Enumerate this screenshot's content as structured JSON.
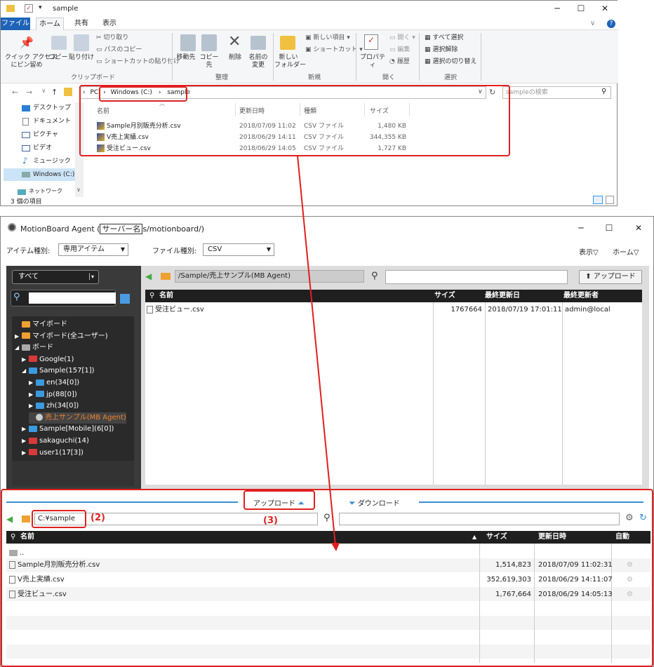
{
  "explorer": {
    "title": "sample",
    "tabs": [
      "ファイル",
      "ホーム",
      "共有",
      "表示"
    ],
    "ribbon": {
      "pin": "クイック アクセス\nにピン留め",
      "copy": "コピー",
      "paste": "貼り付け",
      "cut": "切り取り",
      "copy_path": "パスのコピー",
      "paste_shortcut": "ショートカットの貼り付け",
      "clipboard_group": "クリップボード",
      "move_to": "移動先",
      "copy_to": "コピー先",
      "delete": "削除",
      "rename": "名前の\n変更",
      "organize_group": "整理",
      "new_folder": "新しい\nフォルダー",
      "new_item": "新しい項目 ▾",
      "easy_access": "ショートカット ▾",
      "new_group": "新規",
      "properties": "プロパティ",
      "open": "開く ▾",
      "edit": "編集",
      "history": "履歴",
      "open_group": "開く",
      "select_all": "すべて選択",
      "select_none": "選択解除",
      "invert_selection": "選択の切り替え",
      "select_group": "選択"
    },
    "address": {
      "pc": "PC",
      "drive": "Windows (C:)",
      "folder": "sample"
    },
    "search_placeholder": "sampleの検索",
    "nav_items": [
      "デスクトップ",
      "ドキュメント",
      "ピクチャ",
      "ビデオ",
      "ミュージック",
      "Windows (C:)",
      "ネットワーク"
    ],
    "columns": [
      "名前",
      "更新日時",
      "種類",
      "サイズ"
    ],
    "files": [
      {
        "name": "Sample月別販売分析.csv",
        "date": "2018/07/09 11:02",
        "type": "CSV ファイル",
        "size": "1,480 KB"
      },
      {
        "name": "V売上実績.csv",
        "date": "2018/06/29 14:11",
        "type": "CSV ファイル",
        "size": "344,355 KB"
      },
      {
        "name": "受注ビュー.csv",
        "date": "2018/06/29 14:05",
        "type": "CSV ファイル",
        "size": "1,727 KB"
      }
    ],
    "status": "3 個の項目"
  },
  "mb": {
    "title_prefix": "MotionBoard Agent (",
    "title_server": "サーバー名",
    "title_suffix": "s/motionboard/)",
    "item_type_label": "アイテム種別:",
    "item_type_value": "専用アイテム",
    "file_type_label": "ファイル種別:",
    "file_type_value": "CSV",
    "view_menu": "表示▽",
    "home_menu": "ホーム▽",
    "scope_value": "すべて",
    "path": "/Sample/売上サンプル(MB Agent)",
    "upload_button": "アップロード",
    "tree": [
      {
        "label": "マイボード",
        "color": "or",
        "indent": 0,
        "arrow": ""
      },
      {
        "label": "マイボード(全ユーザー)",
        "color": "or",
        "indent": 0,
        "arrow": "▶"
      },
      {
        "label": "ボード",
        "color": "gray",
        "indent": 0,
        "arrow": "◢"
      },
      {
        "label": "Google(1)",
        "color": "red",
        "indent": 1,
        "arrow": "▶"
      },
      {
        "label": "Sample(157[1])",
        "color": "blue",
        "indent": 1,
        "arrow": "◢"
      },
      {
        "label": "en(34[0])",
        "color": "blue",
        "indent": 2,
        "arrow": "▶"
      },
      {
        "label": "jp(88[0])",
        "color": "blue",
        "indent": 2,
        "arrow": "▶"
      },
      {
        "label": "zh(34[0])",
        "color": "blue",
        "indent": 2,
        "arrow": "▶"
      },
      {
        "label": "売上サンプル(MB Agent)",
        "color": "sel",
        "indent": 2,
        "arrow": ""
      },
      {
        "label": "Sample[Mobile](6[0])",
        "color": "blue",
        "indent": 1,
        "arrow": "▶"
      },
      {
        "label": "sakaguchi(14)",
        "color": "red",
        "indent": 1,
        "arrow": "▶"
      },
      {
        "label": "user1(17[3])",
        "color": "red",
        "indent": 1,
        "arrow": "▶"
      }
    ],
    "server_columns": [
      "名前",
      "サイズ",
      "最終更新日",
      "最終更新者"
    ],
    "server_files": [
      {
        "name": "受注ビュー.csv",
        "size": "1767664",
        "date": "2018/07/19 17:01:11",
        "user": "admin@local"
      }
    ],
    "upload_tab": "アップロード",
    "download_tab": "ダウンロード",
    "local_path": "C:¥sample",
    "local_columns": [
      "名前",
      "サイズ",
      "更新日時",
      "自動"
    ],
    "parent_dir": "..",
    "local_files": [
      {
        "name": "Sample月別販売分析.csv",
        "size": "1,514,823",
        "date": "2018/07/09 11:02:31"
      },
      {
        "name": "V売上実績.csv",
        "size": "352,619,303",
        "date": "2018/06/29 14:11:07"
      },
      {
        "name": "受注ビュー.csv",
        "size": "1,767,664",
        "date": "2018/06/29 14:05:13"
      }
    ]
  },
  "annotations": {
    "a2": "(2)",
    "a3": "(3)"
  },
  "colors": {
    "accent": "#1e63b8",
    "annot": "#e02020",
    "dark": "#3a3a3a"
  }
}
